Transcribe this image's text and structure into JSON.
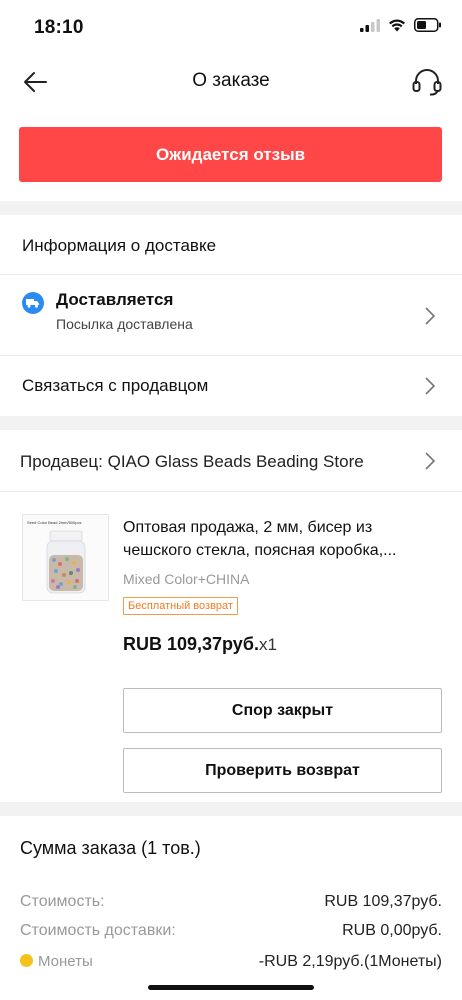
{
  "status_bar": {
    "time": "18:10"
  },
  "nav": {
    "title": "О заказе",
    "back_icon": "arrow-left-icon",
    "support_icon": "headset-icon"
  },
  "order_status": {
    "label": "Ожидается отзыв",
    "color": "#ff4747"
  },
  "delivery": {
    "heading": "Информация о доставке",
    "status_title": "Доставляется",
    "status_subtitle": "Посылка доставлена",
    "status_icon": "truck-icon"
  },
  "contact_seller": {
    "label": "Связаться с продавцом"
  },
  "seller": {
    "label": "Продавец: QIAO Glass Beads Beading Store"
  },
  "product": {
    "title": "Оптовая продажа, 2 мм, бисер из чешского стекла, поясная коробка,...",
    "variant": "Mixed Color+CHINA",
    "badge": "Бесплатный возврат",
    "price": "RUB 109,37руб.",
    "quantity": "x1",
    "thumb_caption": "Seed Color Bead 2mm/500pcs"
  },
  "actions": {
    "dispute_closed": "Спор закрыт",
    "check_return": "Проверить возврат"
  },
  "summary": {
    "title": "Сумма заказа (1 тов.)",
    "lines": [
      {
        "label": "Стоимость:",
        "value": "RUB 109,37руб."
      },
      {
        "label": "Стоимость доставки:",
        "value": "RUB 0,00руб."
      },
      {
        "label": "Монеты",
        "value": "-RUB 2,19руб.(1Монеты)"
      }
    ]
  }
}
